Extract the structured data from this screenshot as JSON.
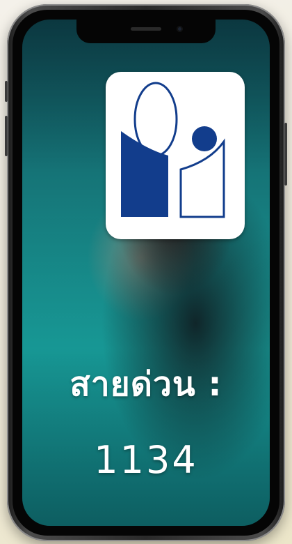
{
  "hotline": {
    "label": "สายด่วน :",
    "number": "1134"
  },
  "logo": {
    "name": "organization-logo",
    "primary_color": "#123d8c",
    "background_color": "#ffffff"
  },
  "icons": [
    "front-camera-icon",
    "speaker-grille-icon"
  ]
}
